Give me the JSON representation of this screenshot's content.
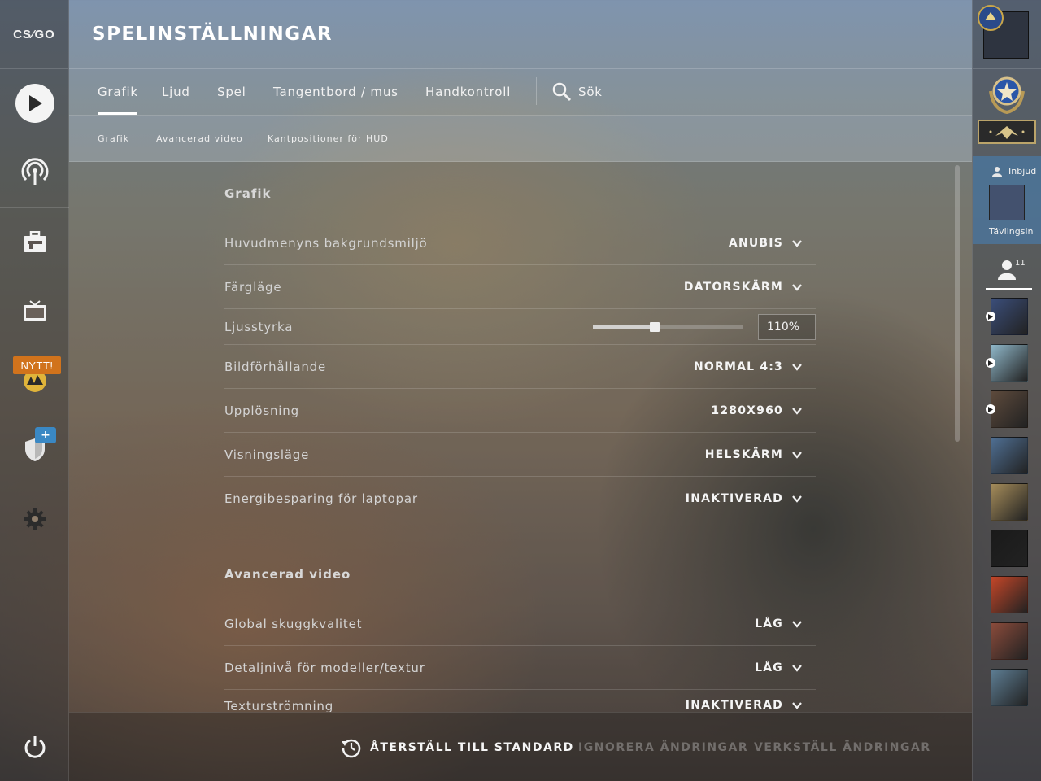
{
  "app": {
    "logo_text": "CS⁄GO"
  },
  "page_title": "SPELINSTÄLLNINGAR",
  "leftnav": {
    "items": [
      {
        "name": "play",
        "icon": "play-icon"
      },
      {
        "name": "broadcast",
        "icon": "broadcast-icon"
      },
      {
        "name": "inventory",
        "icon": "briefcase-icon"
      },
      {
        "name": "watch",
        "icon": "tv-icon"
      },
      {
        "name": "operation",
        "icon": "operation-icon",
        "badge": "NYTT!"
      },
      {
        "name": "shield",
        "icon": "shield-icon",
        "badge": "+"
      },
      {
        "name": "settings",
        "icon": "gear-icon"
      }
    ],
    "power_icon": "power-icon",
    "new_badge": "NYTT!",
    "plus_badge": "+"
  },
  "tabs": [
    "Grafik",
    "Ljud",
    "Spel",
    "Tangentbord / mus",
    "Handkontroll"
  ],
  "search_label": "Sök",
  "active_tab": "Grafik",
  "subtabs": [
    "Grafik",
    "Avancerad video",
    "Kantpositioner för HUD"
  ],
  "sections": {
    "grafik": {
      "title": "Grafik",
      "rows": [
        {
          "label": "Huvudmenyns bakgrundsmiljö",
          "value": "ANUBIS"
        },
        {
          "label": "Färgläge",
          "value": "DATORSKÄRM"
        },
        {
          "label": "Ljusstyrka",
          "value": "110%",
          "slider_fraction": 0.41
        },
        {
          "label": "Bildförhållande",
          "value": "NORMAL 4:3"
        },
        {
          "label": "Upplösning",
          "value": "1280X960"
        },
        {
          "label": "Visningsläge",
          "value": "HELSKÄRM"
        },
        {
          "label": "Energibesparing för laptopar",
          "value": "INAKTIVERAD"
        }
      ]
    },
    "advanced": {
      "title": "Avancerad video",
      "rows": [
        {
          "label": "Global skuggkvalitet",
          "value": "LÅG"
        },
        {
          "label": "Detaljnivå för modeller/textur",
          "value": "LÅG"
        },
        {
          "label": "Texturströmning",
          "value": "INAKTIVERAD"
        }
      ]
    }
  },
  "bottom": {
    "reset": "ÅTERSTÄLL TILL STANDARD",
    "discard": "IGNORERA ÄNDRINGAR",
    "apply": "VERKSTÄLL ÄNDRINGAR"
  },
  "rightbar": {
    "invite_label": "Inbjud",
    "competitive_label": "Tävlingsin",
    "friend_count": "11",
    "colors": [
      "#3b4e7a",
      "#8fb7c9",
      "#5d4a3c",
      "#4f6f93",
      "#a58c5a",
      "#1a1a1a",
      "#c44628",
      "#8a4b3b",
      "#5d7d93"
    ]
  }
}
